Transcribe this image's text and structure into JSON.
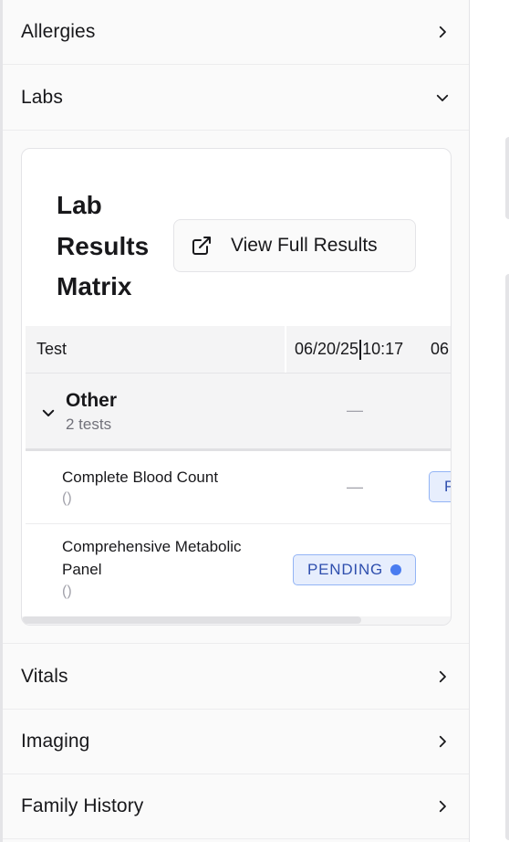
{
  "sections": {
    "allergies": {
      "label": "Allergies",
      "expanded": false
    },
    "labs": {
      "label": "Labs",
      "expanded": true
    },
    "vitals": {
      "label": "Vitals",
      "expanded": false
    },
    "imaging": {
      "label": "Imaging",
      "expanded": false
    },
    "family_history": {
      "label": "Family History",
      "expanded": false
    }
  },
  "lab_card": {
    "title": "Lab Results Matrix",
    "view_button_label": "View Full Results",
    "view_button_icon": "external-link-icon",
    "table": {
      "header_test": "Test",
      "date_col_1_date": "06/20/25",
      "date_col_1_time": "10:17",
      "date_col_2_partial": "06",
      "group": {
        "name": "Other",
        "count_label": "2 tests",
        "col1_value": "—"
      },
      "rows": [
        {
          "name": "Complete Blood Count",
          "unit": "()",
          "col1_value": "—",
          "col2_partial_badge": "P"
        },
        {
          "name": "Comprehensive Metabolic Panel",
          "unit": "()",
          "col1_badge": "PENDING"
        }
      ]
    }
  },
  "colors": {
    "badge_bg": "#e7eefd",
    "badge_border": "#93b4f5",
    "badge_text": "#2f4fae",
    "badge_dot": "#4a7cf0"
  }
}
